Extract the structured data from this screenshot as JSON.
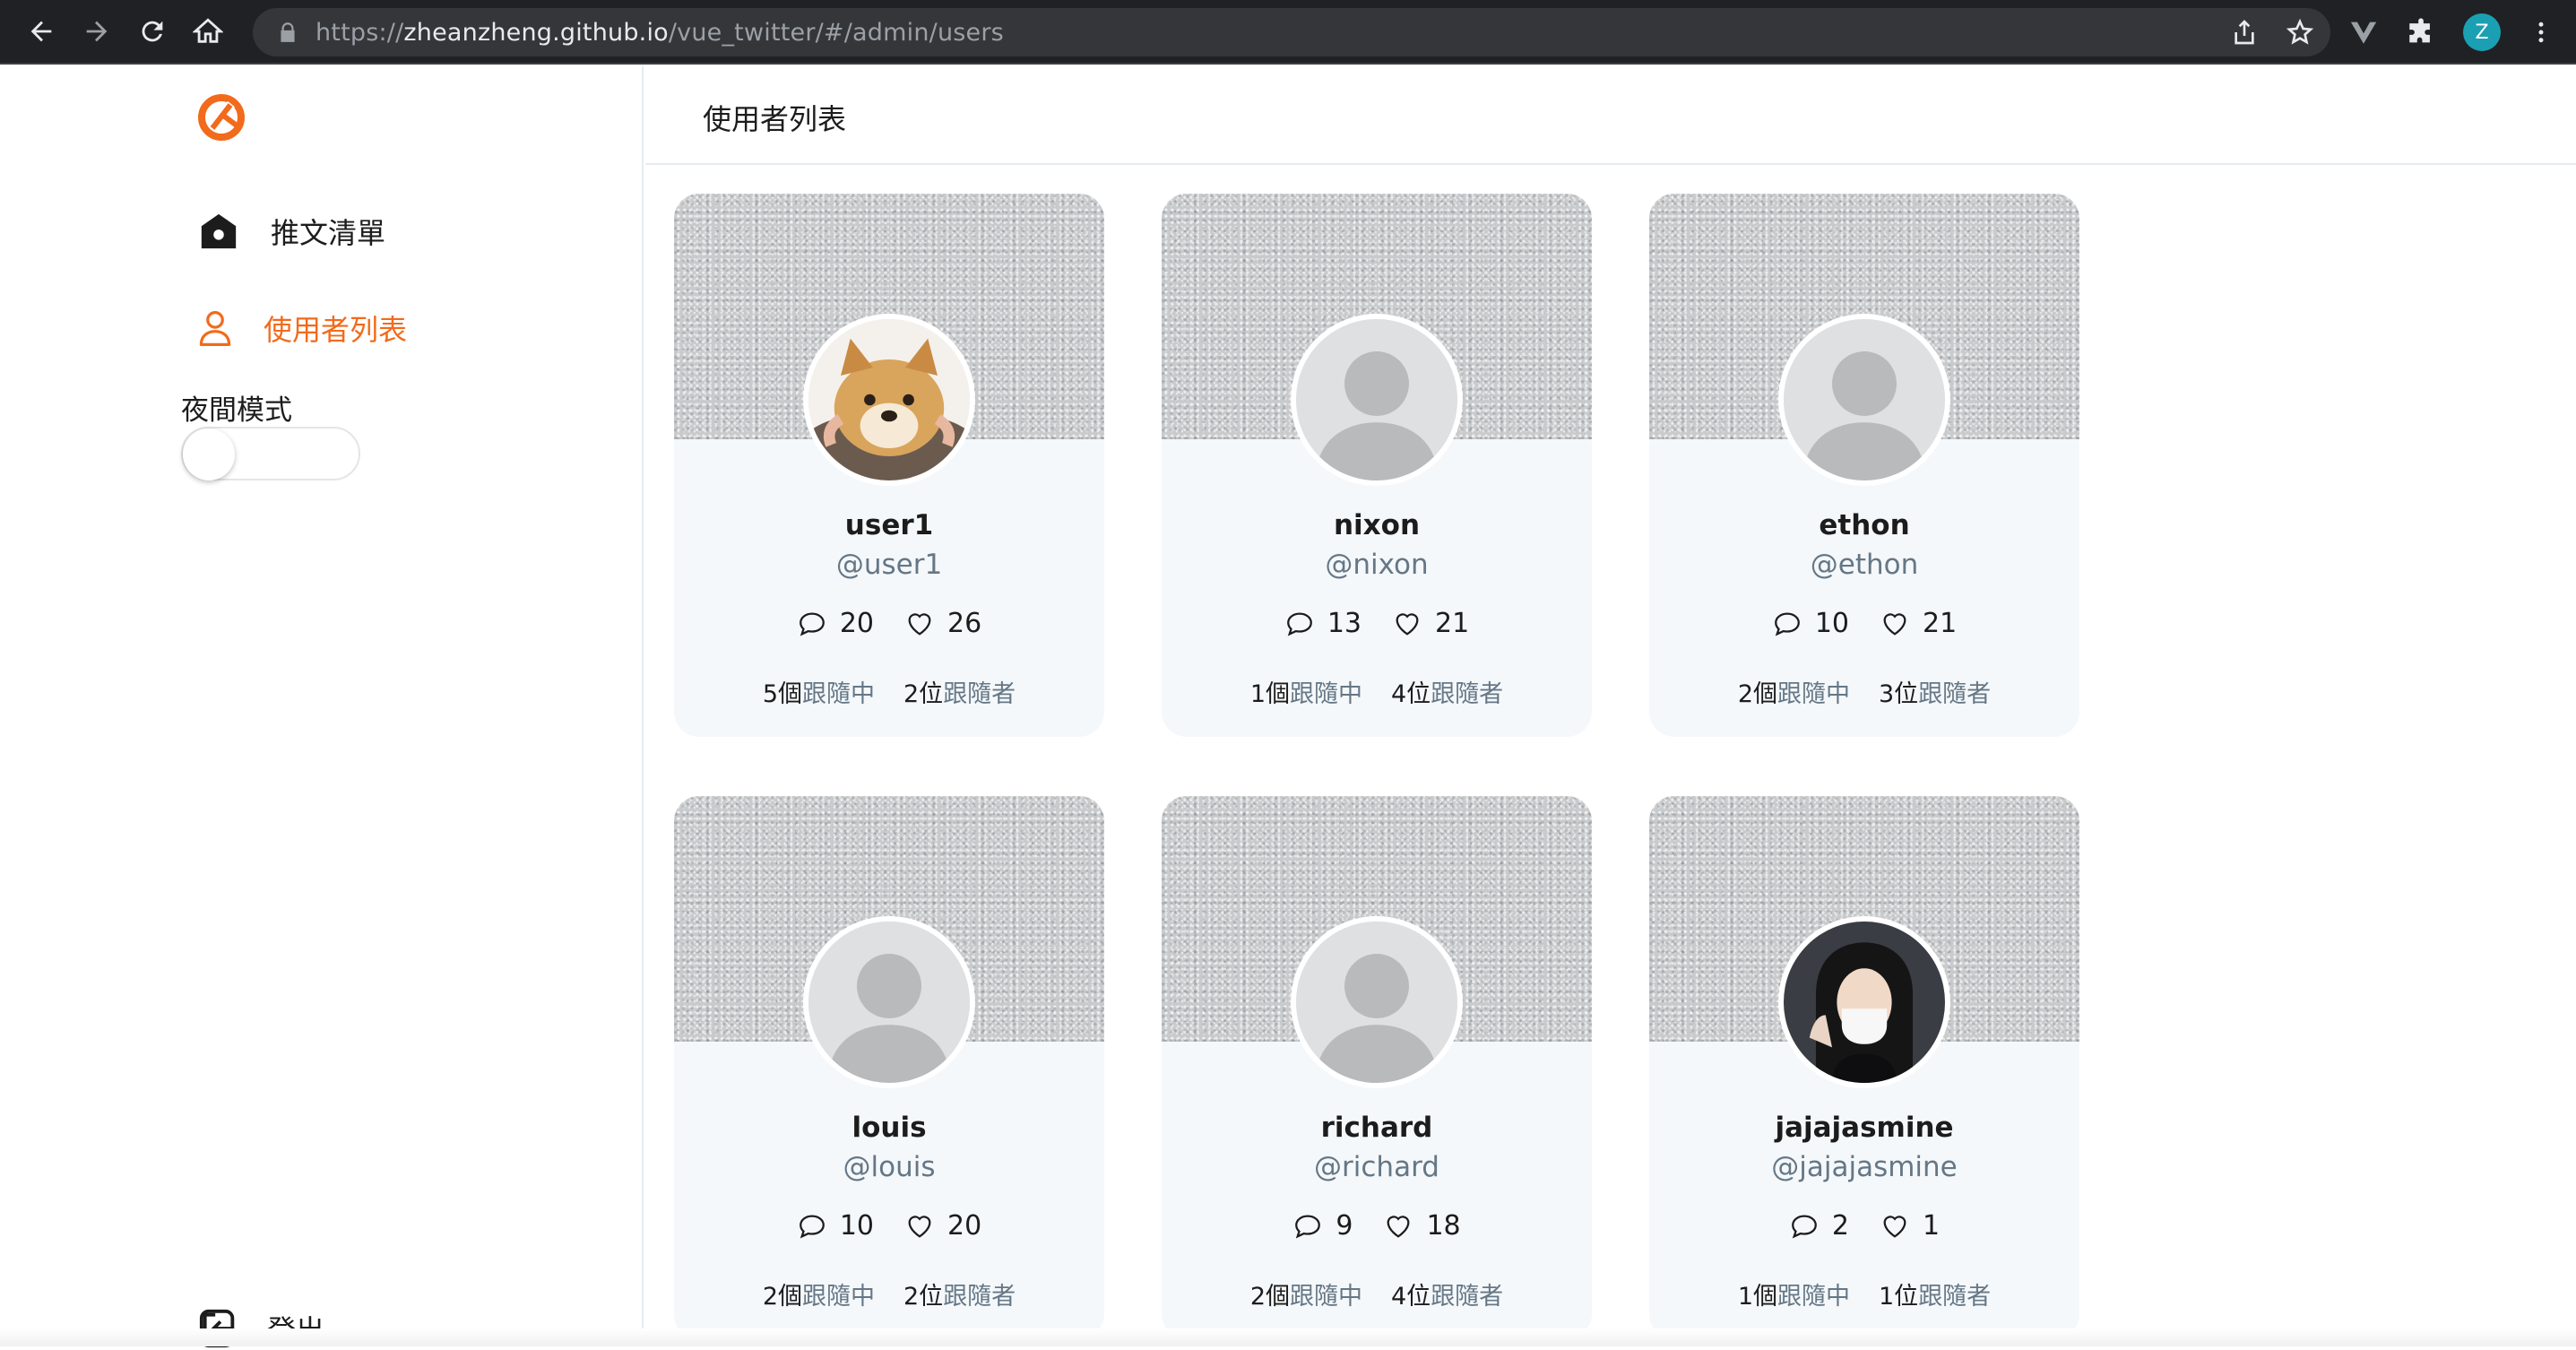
{
  "browser": {
    "url_prefix": "https://",
    "url_host": "zheanzheng.github.io",
    "url_path": "/vue_twitter/#/admin/users",
    "profile_initial": "Z"
  },
  "sidebar": {
    "brand_color": "#f26a1b",
    "items": [
      {
        "label": "推文清單",
        "icon": "home-icon"
      },
      {
        "label": "使用者列表",
        "icon": "user-icon",
        "active": true
      }
    ],
    "dark_mode_label": "夜間模式",
    "dark_mode_on": false,
    "logout_label": "登出"
  },
  "main": {
    "title": "使用者列表"
  },
  "users": [
    {
      "name": "user1",
      "handle": "@user1",
      "replies": "20",
      "likes": "26",
      "following_count": "5個",
      "following_label": "跟隨中",
      "followers_count": "2位",
      "followers_label": "跟隨者",
      "avatar": "shiba-dog-photo"
    },
    {
      "name": "nixon",
      "handle": "@nixon",
      "replies": "13",
      "likes": "21",
      "following_count": "1個",
      "following_label": "跟隨中",
      "followers_count": "4位",
      "followers_label": "跟隨者",
      "avatar": "default-avatar"
    },
    {
      "name": "ethon",
      "handle": "@ethon",
      "replies": "10",
      "likes": "21",
      "following_count": "2個",
      "following_label": "跟隨中",
      "followers_count": "3位",
      "followers_label": "跟隨者",
      "avatar": "default-avatar"
    },
    {
      "name": "louis",
      "handle": "@louis",
      "replies": "10",
      "likes": "20",
      "following_count": "2個",
      "following_label": "跟隨中",
      "followers_count": "2位",
      "followers_label": "跟隨者",
      "avatar": "default-avatar"
    },
    {
      "name": "richard",
      "handle": "@richard",
      "replies": "9",
      "likes": "18",
      "following_count": "2個",
      "following_label": "跟隨中",
      "followers_count": "4位",
      "followers_label": "跟隨者",
      "avatar": "default-avatar"
    },
    {
      "name": "jajajasmine",
      "handle": "@jajajasmine",
      "replies": "2",
      "likes": "1",
      "following_count": "1個",
      "following_label": "跟隨中",
      "followers_count": "1位",
      "followers_label": "跟隨者",
      "avatar": "person-photo"
    }
  ]
}
